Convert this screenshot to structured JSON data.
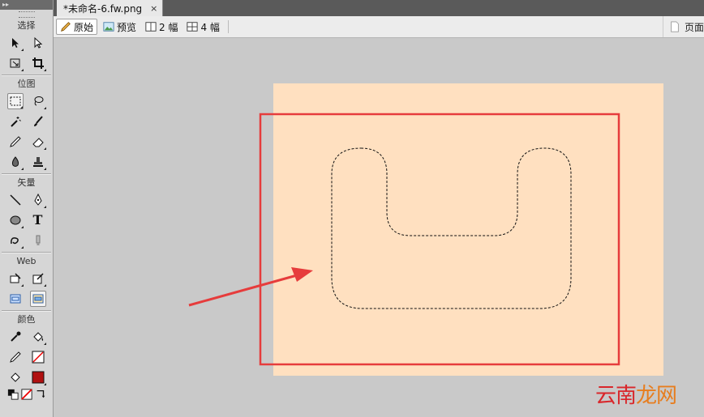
{
  "tools_panel": {
    "sections": {
      "select": "选择",
      "bitmap": "位图",
      "vector": "矢量",
      "web": "Web",
      "colors": "颜色"
    },
    "text_tool_glyph": "T"
  },
  "document": {
    "tab_title": "*未命名-6.fw.png",
    "close_glyph": "×"
  },
  "view_toolbar": {
    "original": "原始",
    "preview": "预览",
    "two_up": "2 幅",
    "four_up": "4 幅",
    "page": "页面"
  },
  "watermark": {
    "part1": "云南",
    "part2": "龙网"
  },
  "colors": {
    "canvas": "#ffe0c0",
    "annotation_red": "#e63c3c",
    "stroke_color": "#cc0000"
  }
}
